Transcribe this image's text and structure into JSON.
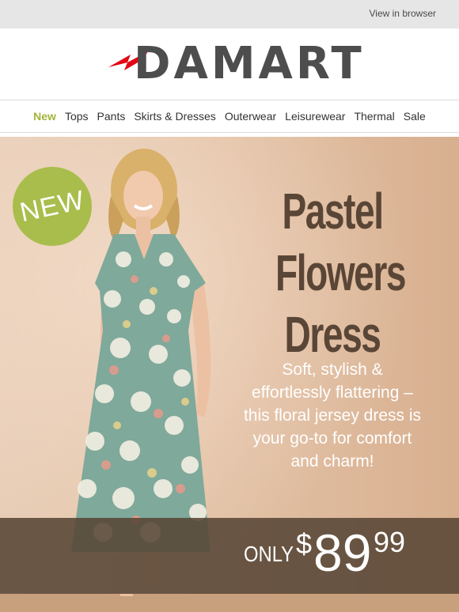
{
  "topbar": {
    "view_in_browser": "View in browser"
  },
  "brand": {
    "name": "DAMART"
  },
  "nav": {
    "items": [
      {
        "label": "New",
        "active": true
      },
      {
        "label": "Tops",
        "active": false
      },
      {
        "label": "Pants",
        "active": false
      },
      {
        "label": "Skirts & Dresses",
        "active": false
      },
      {
        "label": "Outerwear",
        "active": false
      },
      {
        "label": "Leisurewear",
        "active": false
      },
      {
        "label": "Thermal",
        "active": false
      },
      {
        "label": "Sale",
        "active": false
      }
    ]
  },
  "hero": {
    "badge": "NEW",
    "headline": [
      "Pastel",
      "Flowers",
      "Dress"
    ],
    "subcopy": [
      "Soft, stylish &",
      "effortlessly flattering –",
      "this floral jersey dress is",
      "your go-to for comfort",
      "and charm!"
    ],
    "price": {
      "prefix": "ONLY",
      "currency": "$",
      "dollars": "89",
      "cents": "99"
    }
  },
  "colors": {
    "accent_green": "#a9bd4c",
    "brand_gray": "#4d4d4d",
    "logo_red": "#e30613",
    "headline_brown": "#5a4636",
    "dress_green": "#7fa99a"
  }
}
